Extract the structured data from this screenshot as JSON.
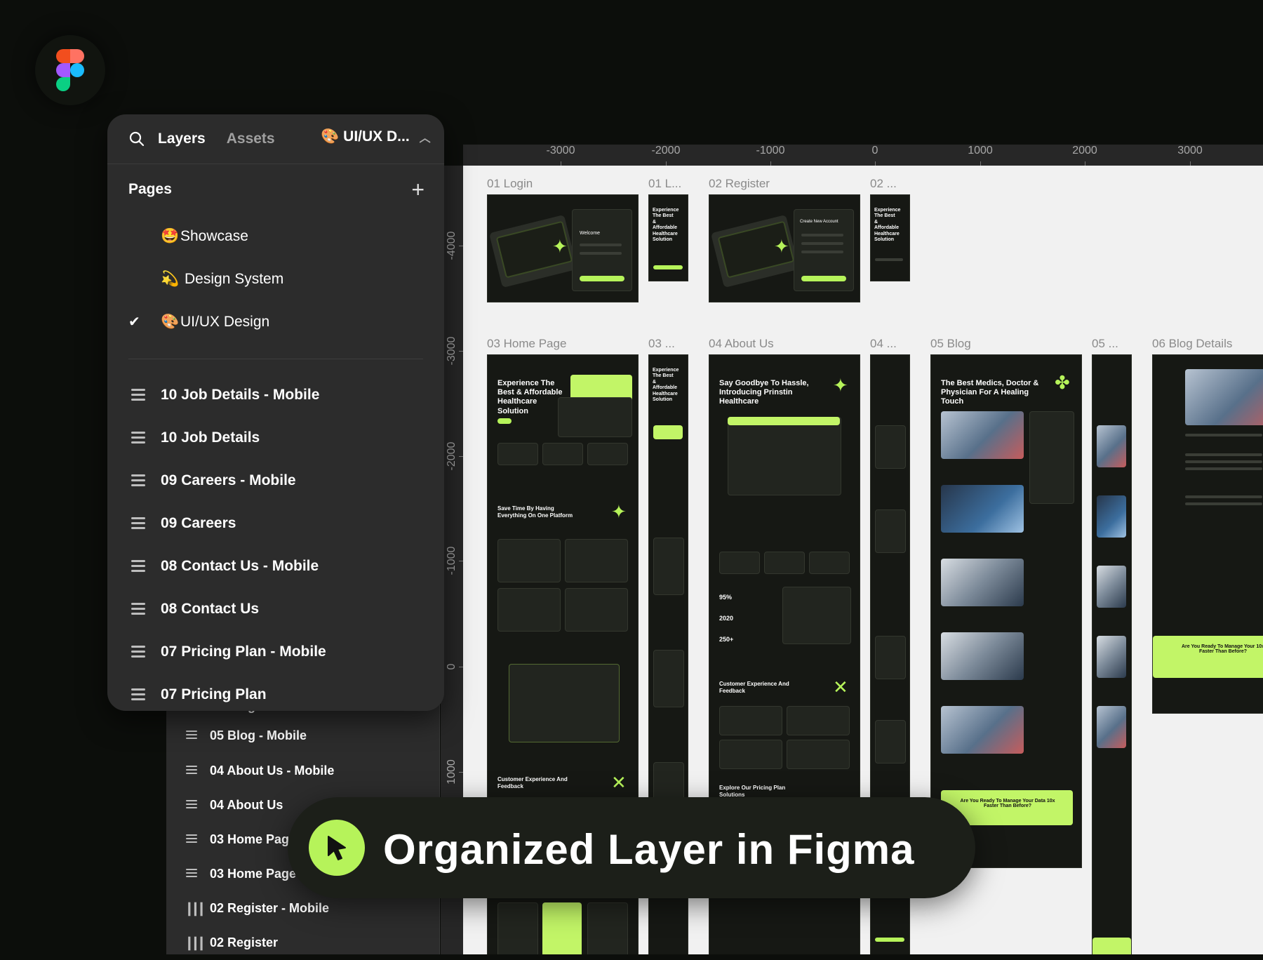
{
  "panel": {
    "tabs": [
      "Layers",
      "Assets"
    ],
    "file_title": "UI/UX D...",
    "pages_title": "Pages",
    "pages": [
      {
        "emoji": "🤩",
        "label": "Showcase",
        "selected": false
      },
      {
        "emoji": "💫",
        "label": "Design System",
        "selected": false
      },
      {
        "emoji": "🎨",
        "label": "UI/UX Design",
        "selected": true
      }
    ],
    "layers": [
      "10 Job Details - Mobile",
      "10 Job Details",
      "09 Careers - Mobile",
      "09 Careers",
      "08 Contact Us - Mobile",
      "08 Contact Us",
      "07 Pricing Plan - Mobile",
      "07 Pricing Plan"
    ]
  },
  "back_layers": [
    "05 Blog",
    "05 Blog - Mobile",
    "04 About Us - Mobile",
    "04 About Us",
    "03 Home Pag",
    "03 Home Page",
    "02 Register - Mobile",
    "02 Register"
  ],
  "ruler": {
    "top": [
      "-3000",
      "-2000",
      "-1000",
      "0",
      "1000",
      "2000",
      "3000"
    ],
    "left": [
      "-4000",
      "-3000",
      "-2000",
      "-1000",
      "0",
      "1000"
    ]
  },
  "frames": {
    "login": "01 Login",
    "login_m": "01 L...",
    "register": "02 Register",
    "register_m": "02 ...",
    "home": "03 Home Page",
    "home_m": "03 ...",
    "about": "04 About Us",
    "about_m": "04 ...",
    "blog": "05 Blog",
    "blog_m": "05 ...",
    "blog_details": "06 Blog Details"
  },
  "frame_text": {
    "home_hero": "Experience The Best & Affordable Healthcare Solution",
    "home_feature": "Save Time By Having Everything On One Platform",
    "home_feedback": "Customer Experience And Feedback",
    "about_hero": "Say Goodbye To Hassle, Introducing Prinstin Healthcare",
    "about_feedback": "Customer Experience And Feedback",
    "about_pricing": "Explore Our Pricing Plan Solutions",
    "about_stat1": "95%",
    "about_stat2": "2020",
    "about_stat3": "250+",
    "blog_hero": "The Best Medics, Doctor & Physician For A Healing Touch",
    "blog_cta": "Are You Ready To Manage Your Data 10x Faster Than Before?",
    "details_cta": "Are You Ready To Manage Your 10x Faster Than Before?",
    "login_welcome": "Welcome",
    "register_title": "Create New Account",
    "mobile_hero": "Experience The Best & Affordable Healthcare Solution"
  },
  "banner": {
    "text": "Organized Layer in Figma"
  },
  "colors": {
    "accent": "#b6f35a",
    "canvas": "#f1f1f1",
    "panel": "#2c2c2c",
    "background": "#0c0e0b"
  }
}
